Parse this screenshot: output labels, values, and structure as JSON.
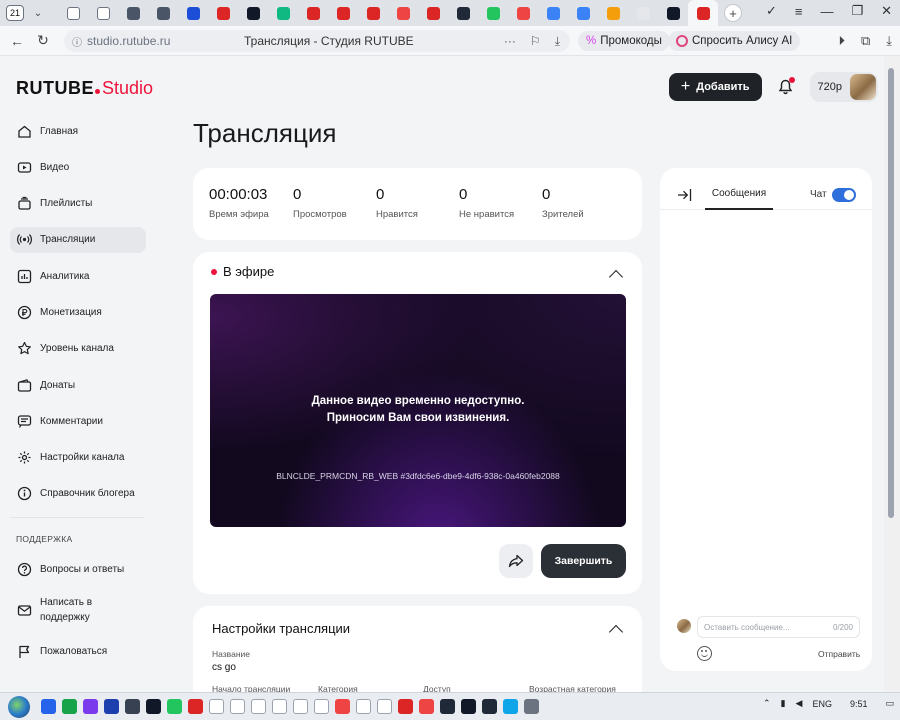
{
  "browser": {
    "tab_count": "21",
    "url_host": "studio.rutube.ru",
    "page_title": "Трансляция - Студия RUTUBE",
    "promo_chip": "Промокоды",
    "alice_chip": "Спросить Алису AI",
    "tab_colors": [
      "#ffffff",
      "#ffffff",
      "#4a5568",
      "#4a5568",
      "#1d4ed8",
      "#dc2626",
      "#111827",
      "#10b981",
      "#dc2626",
      "#dc2626",
      "#dc2626",
      "#ef4444",
      "#dc2626",
      "#1f2937",
      "#22c55e",
      "#ef4444",
      "#3b82f6",
      "#3b82f6",
      "#f59e0b",
      "#e5e7eb",
      "#111827",
      "#dc2626"
    ]
  },
  "header": {
    "logo_main": "RUTUBE",
    "logo_studio": "Studio",
    "add_label": "Добавить",
    "quality": "720p"
  },
  "sidebar": {
    "items": [
      {
        "label": "Главная",
        "icon": "home-icon"
      },
      {
        "label": "Видео",
        "icon": "video-icon"
      },
      {
        "label": "Плейлисты",
        "icon": "playlist-icon"
      },
      {
        "label": "Трансляции",
        "icon": "broadcast-icon",
        "active": true
      },
      {
        "label": "Аналитика",
        "icon": "analytics-icon"
      },
      {
        "label": "Монетизация",
        "icon": "monetization-icon"
      },
      {
        "label": "Уровень канала",
        "icon": "star-icon"
      },
      {
        "label": "Донаты",
        "icon": "donate-icon"
      },
      {
        "label": "Комментарии",
        "icon": "comments-icon"
      },
      {
        "label": "Настройки канала",
        "icon": "settings-icon"
      },
      {
        "label": "Справочник блогера",
        "icon": "info-icon"
      }
    ],
    "support_heading": "ПОДДЕРЖКА",
    "support_items": [
      {
        "label": "Вопросы и ответы",
        "icon": "help-icon"
      },
      {
        "label": "Написать в поддержку",
        "icon": "mail-icon"
      },
      {
        "label": "Пожаловаться",
        "icon": "flag-icon"
      }
    ]
  },
  "main": {
    "title": "Трансляция",
    "stats": [
      {
        "value": "00:00:03",
        "label": "Время эфира"
      },
      {
        "value": "0",
        "label": "Просмотров"
      },
      {
        "value": "0",
        "label": "Нравится"
      },
      {
        "value": "0",
        "label": "Не нравится"
      },
      {
        "value": "0",
        "label": "Зрителей"
      }
    ],
    "live": {
      "heading": "В эфире",
      "message_line1": "Данное видео временно недоступно.",
      "message_line2": "Приносим Вам свои извинения.",
      "error_code": "BLNCLDE_PRMCDN_RB_WEB #3dfdc6e6-dbe9-4df6-938c-0a460feb2088",
      "finish_label": "Завершить"
    },
    "settings": {
      "heading": "Настройки трансляции",
      "name_label": "Название",
      "name_value": "cs go",
      "fields": [
        "Начало трансляции",
        "Категория",
        "Доступ",
        "Возрастная категория"
      ]
    }
  },
  "chat": {
    "messages_tab": "Сообщения",
    "chat_label": "Чат",
    "chat_enabled": true,
    "input_placeholder": "Оставить сообщение...",
    "char_count": "0/200",
    "send_label": "Отправить"
  },
  "taskbar": {
    "lang": "ENG",
    "time": "9:51"
  }
}
